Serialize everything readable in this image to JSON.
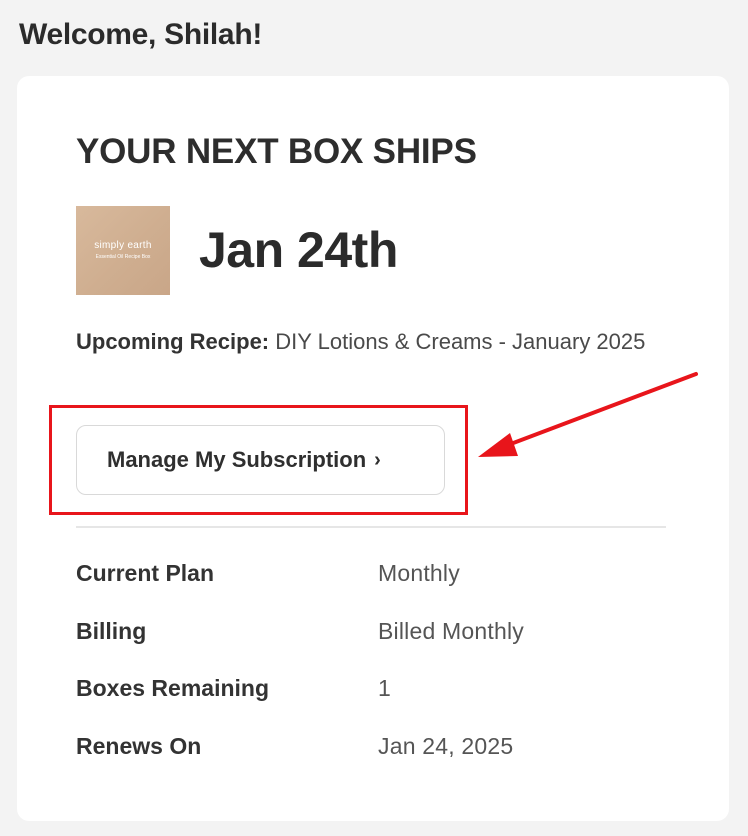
{
  "header": {
    "welcome": "Welcome, Shilah!"
  },
  "next_box": {
    "heading": "YOUR NEXT BOX SHIPS",
    "date": "Jan 24th",
    "thumbnail": {
      "brand": "simply earth",
      "subtitle": "Essential Oil Recipe Box"
    },
    "recipe_label": "Upcoming Recipe:",
    "recipe_value": "DIY Lotions & Creams - January 2025",
    "manage_button": "Manage My Subscription",
    "chevron": "›"
  },
  "details": [
    {
      "label": "Current Plan",
      "value": "Monthly"
    },
    {
      "label": "Billing",
      "value": "Billed Monthly"
    },
    {
      "label": "Boxes Remaining",
      "value": "1"
    },
    {
      "label": "Renews On",
      "value": "Jan 24, 2025"
    }
  ],
  "colors": {
    "background": "#f3f3f3",
    "card": "#ffffff",
    "annotation": "#e8151b"
  },
  "icons": {
    "chevron": "chevron-right-icon",
    "annotation_arrow": "red-arrow-icon"
  }
}
